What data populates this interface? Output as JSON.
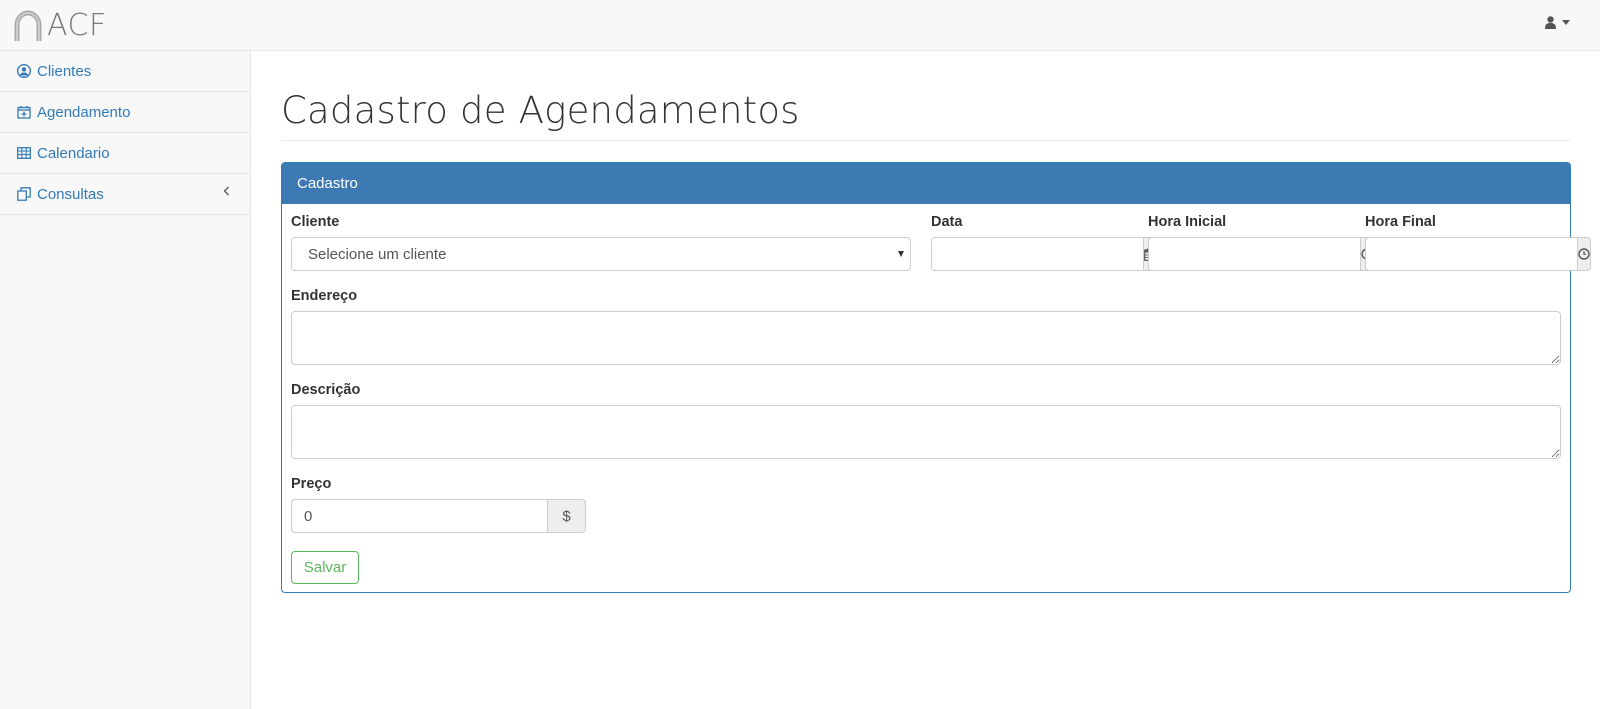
{
  "brand": {
    "name": "ACF"
  },
  "sidebar": {
    "items": [
      {
        "label": "Clientes",
        "icon": "user-circle-icon"
      },
      {
        "label": "Agendamento",
        "icon": "calendar-plus-icon"
      },
      {
        "label": "Calendario",
        "icon": "table-icon"
      },
      {
        "label": "Consultas",
        "icon": "copy-icon"
      }
    ]
  },
  "page": {
    "title": "Cadastro de Agendamentos"
  },
  "panel": {
    "heading": "Cadastro"
  },
  "form": {
    "cliente_label": "Cliente",
    "cliente_value": "Selecione um cliente",
    "data_label": "Data",
    "hora_inicial_label": "Hora Inicial",
    "hora_final_label": "Hora Final",
    "endereco_label": "Endereço",
    "descricao_label": "Descrição",
    "preco_label": "Preço",
    "preco_value": "0",
    "preco_addon": "$",
    "save_label": "Salvar"
  },
  "colors": {
    "primary": "#337ab7",
    "panel_heading": "#3d79b3",
    "success": "#5cb85c"
  }
}
